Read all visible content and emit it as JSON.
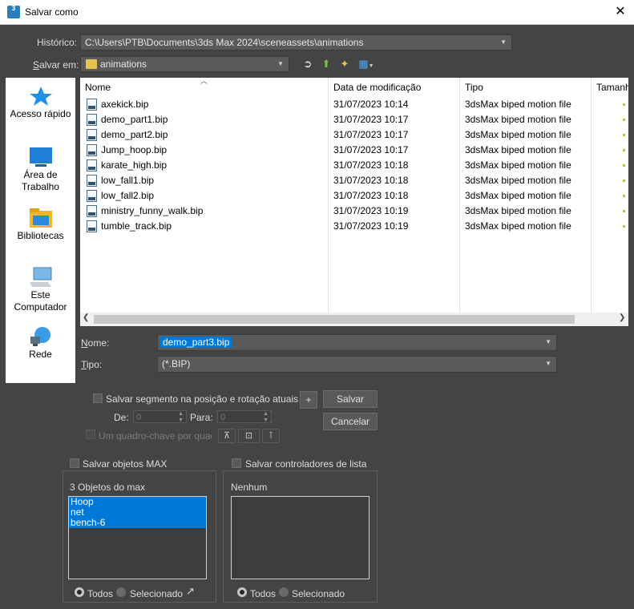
{
  "window": {
    "title": "Salvar como",
    "app_icon_label": "3"
  },
  "historico": {
    "label": "Histórico:",
    "value": "C:\\Users\\PTB\\Documents\\3ds Max 2024\\sceneassets\\animations"
  },
  "salvar_em": {
    "label": "Salvar em:",
    "value": "animations"
  },
  "toolbar_icons": [
    "back-icon",
    "up-folder-icon",
    "new-folder-icon",
    "view-menu-icon"
  ],
  "places": [
    {
      "label_line1": "Acesso rápido",
      "label_line2": "",
      "icon": "quick-access-star-icon"
    },
    {
      "label_line1": "Área de",
      "label_line2": "Trabalho",
      "icon": "desktop-icon"
    },
    {
      "label_line1": "Bibliotecas",
      "label_line2": "",
      "icon": "libraries-icon"
    },
    {
      "label_line1": "Este",
      "label_line2": "Computador",
      "icon": "computer-icon"
    },
    {
      "label_line1": "Rede",
      "label_line2": "",
      "icon": "network-icon"
    }
  ],
  "columns": {
    "name": "Nome",
    "date": "Data de modificação",
    "type": "Tipo",
    "size": "Tamanh"
  },
  "files": [
    {
      "name": "axekick.bip",
      "date": "31/07/2023 10:14",
      "type": "3dsMax biped motion file"
    },
    {
      "name": "demo_part1.bip",
      "date": "31/07/2023 10:17",
      "type": "3dsMax biped motion file"
    },
    {
      "name": "demo_part2.bip",
      "date": "31/07/2023 10:17",
      "type": "3dsMax biped motion file"
    },
    {
      "name": "Jump_hoop.bip",
      "date": "31/07/2023 10:17",
      "type": "3dsMax biped motion file"
    },
    {
      "name": "karate_high.bip",
      "date": "31/07/2023 10:18",
      "type": "3dsMax biped motion file"
    },
    {
      "name": "low_fall1.bip",
      "date": "31/07/2023 10:18",
      "type": "3dsMax biped motion file"
    },
    {
      "name": "low_fall2.bip",
      "date": "31/07/2023 10:18",
      "type": "3dsMax biped motion file"
    },
    {
      "name": "ministry_funny_walk.bip",
      "date": "31/07/2023 10:19",
      "type": "3dsMax biped motion file"
    },
    {
      "name": "tumble_track.bip",
      "date": "31/07/2023 10:19",
      "type": "3dsMax biped motion file"
    }
  ],
  "nome": {
    "label": "Nome:",
    "value": "demo_part3.bip"
  },
  "tipo": {
    "label": "Tipo:",
    "value": "(*.BIP)"
  },
  "options": {
    "salvar_segmento": "Salvar segmento na posição e rotação atuais",
    "de_label": "De:",
    "de_value": "0",
    "para_label": "Para:",
    "para_value": "0",
    "keyframe_label": "Um quadro-chave por quadro",
    "plus": "+"
  },
  "buttons": {
    "save": "Salvar",
    "cancel": "Cancelar"
  },
  "objects": {
    "save_max_label": "Salvar objetos MAX",
    "group_title": "3 Objetos do max",
    "items": [
      "Hoop",
      "net",
      "bench-6"
    ],
    "radio_all": "Todos",
    "radio_selected": "Selecionado"
  },
  "controllers": {
    "save_ctrl_label": "Salvar controladores de lista",
    "group_title": "Nenhum",
    "radio_all": "Todos",
    "radio_selected": "Selecionado"
  },
  "colors": {
    "selection": "#0078d7",
    "dialog_bg": "#444444"
  }
}
